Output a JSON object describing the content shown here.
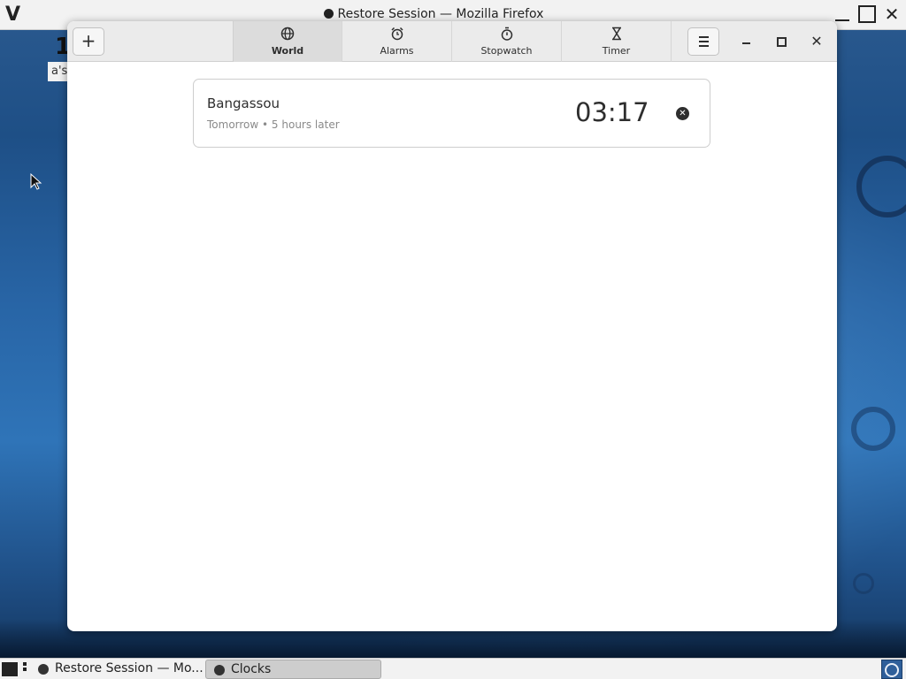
{
  "background_window": {
    "title": "Restore Session — Mozilla Firefox",
    "partial_text_1": "1",
    "partial_text_2": "a's"
  },
  "clocks": {
    "add_label": "+",
    "tabs": [
      {
        "label": "World",
        "icon": "globe-icon",
        "active": true
      },
      {
        "label": "Alarms",
        "icon": "alarm-clock-icon",
        "active": false
      },
      {
        "label": "Stopwatch",
        "icon": "stopwatch-icon",
        "active": false
      },
      {
        "label": "Timer",
        "icon": "hourglass-icon",
        "active": false
      }
    ],
    "world_clocks": [
      {
        "city": "Bangassou",
        "subtitle": "Tomorrow • 5 hours later",
        "time": "03:17"
      }
    ]
  },
  "taskbar": {
    "items": [
      {
        "label": "Restore Session — Mo...",
        "active": false
      },
      {
        "label": "Clocks",
        "active": true
      }
    ]
  },
  "colors": {
    "accent_text": "#2e2e2e",
    "desktop_blue": "#2865a6"
  }
}
